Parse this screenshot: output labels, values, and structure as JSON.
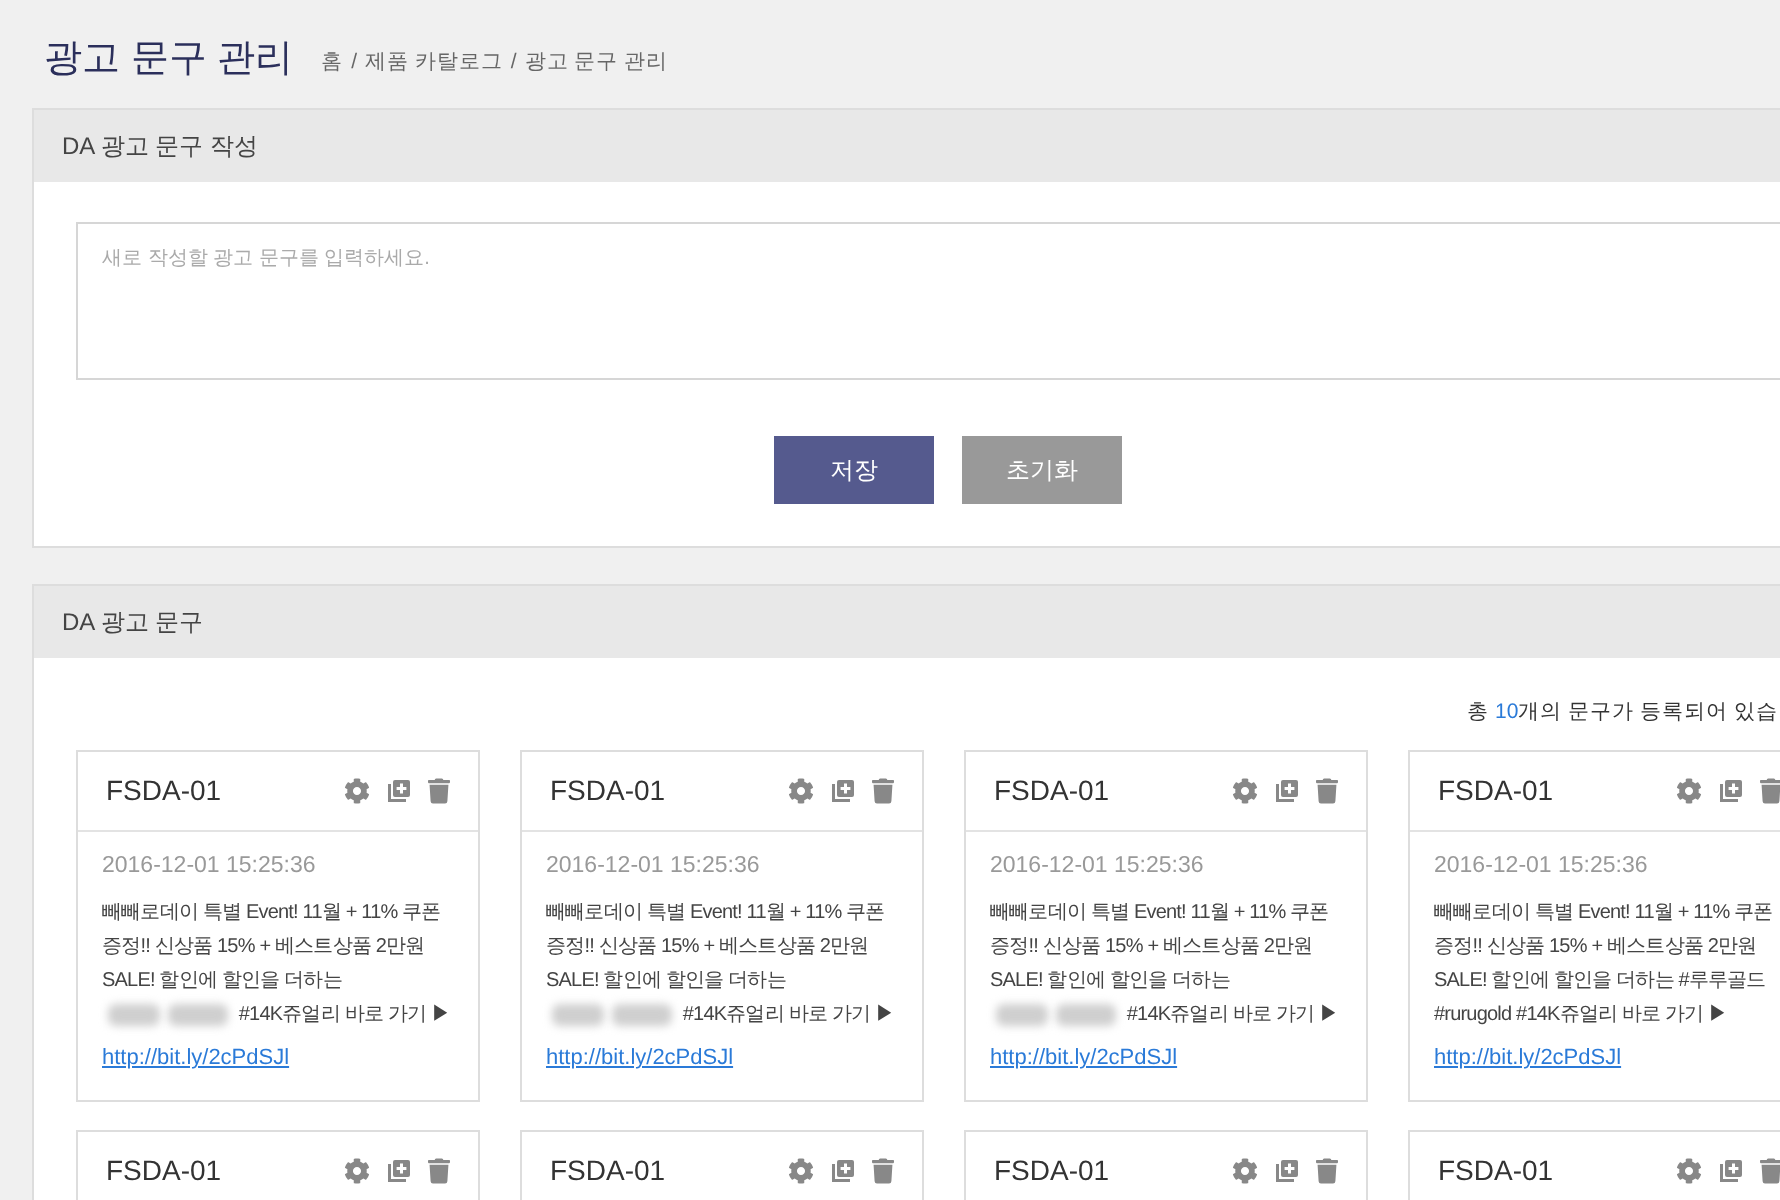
{
  "page": {
    "title": "광고 문구 관리",
    "breadcrumb": [
      "홈",
      "제품 카탈로그",
      "광고 문구 관리"
    ],
    "breadcrumb_separator": "/"
  },
  "compose": {
    "title": "DA 광고 문구 작성",
    "placeholder": "새로 작성할 광고 문구를 입력하세요.",
    "buttons": [
      {
        "label": "저장",
        "kind": "primary"
      },
      {
        "label": "초기화",
        "kind": "secondary"
      }
    ]
  },
  "list": {
    "title": "DA 광고 문구",
    "count": {
      "prefix": "총 ",
      "number": "10",
      "suffix": "개의 문구가 등록되어 있습"
    },
    "cards": [
      {
        "code": "FSDA-01",
        "date": "2016-12-01 15:25:36",
        "text_before": "빼빼로데이 특별 Event! 11월 + 11% 쿠폰 증정!! 신상품 15% + 베스트상품 2만원 SALE!  할인에 할인을 더하는",
        "redacted": true,
        "text_after": "#14K쥬얼리 바로 가기 ▶",
        "link": "http://bit.ly/2cPdSJl"
      },
      {
        "code": "FSDA-01",
        "date": "2016-12-01 15:25:36",
        "text_before": "빼빼로데이 특별 Event! 11월 + 11% 쿠폰 증정!! 신상품 15% + 베스트상품 2만원 SALE!  할인에 할인을 더하는",
        "redacted": true,
        "text_after": "#14K쥬얼리 바로 가기 ▶",
        "link": "http://bit.ly/2cPdSJl"
      },
      {
        "code": "FSDA-01",
        "date": "2016-12-01 15:25:36",
        "text_before": "빼빼로데이 특별 Event! 11월 + 11% 쿠폰 증정!! 신상품 15% + 베스트상품 2만원 SALE!  할인에 할인을 더하는",
        "redacted": true,
        "text_after": "#14K쥬얼리 바로 가기 ▶",
        "link": "http://bit.ly/2cPdSJl"
      },
      {
        "code": "FSDA-01",
        "date": "2016-12-01 15:25:36",
        "text_before": "빼빼로데이 특별 Event! 11월 + 11% 쿠폰 증정!! 신상품 15% + 베스트상품 2만원 SALE!  할인에 할인을 더하는 #루루골드 #rurugold #14K쥬얼리 바로 가기 ▶",
        "redacted": false,
        "link": "http://bit.ly/2cPdSJl"
      },
      {
        "code": "FSDA-01"
      },
      {
        "code": "FSDA-01"
      },
      {
        "code": "FSDA-01"
      },
      {
        "code": "FSDA-01"
      }
    ]
  }
}
